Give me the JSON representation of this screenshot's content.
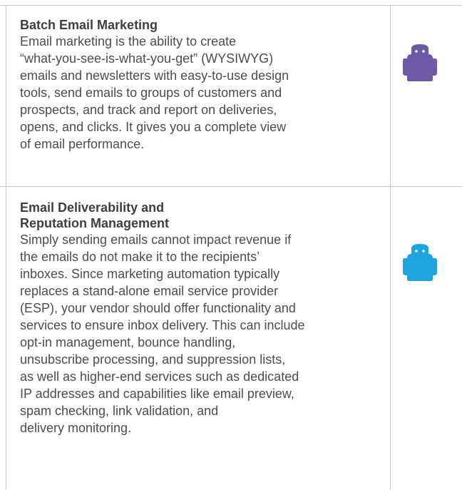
{
  "sections": [
    {
      "heading_lines": [
        "Batch Email Marketing"
      ],
      "body_lines": [
        "Email marketing is the ability to create",
        "“what-you-see-is-what-you-get” (WYSIWYG)",
        "emails and newsletters with easy-to-use design",
        "tools, send emails to groups of customers and",
        "prospects, and track and report on deliveries,",
        "opens, and clicks. It gives you a complete view",
        "of email performance."
      ],
      "icon": "purple-robot-icon",
      "icon_color": "#6c5aa8"
    },
    {
      "heading_lines": [
        "Email Deliverability and",
        "Reputation Management"
      ],
      "body_lines": [
        "Simply sending emails cannot impact revenue if",
        "the emails do not make it to the recipients’",
        "inboxes. Since marketing automation typically",
        "replaces a stand-alone email service provider",
        "(ESP), your vendor should offer functionality and",
        "services to ensure inbox delivery. This can include",
        "opt-in management, bounce handling,",
        "unsubscribe processing, and suppression lists,",
        "as well as higher-end services such as dedicated",
        "IP addresses and capabilities like email preview,",
        "spam checking, link validation, and",
        "delivery monitoring."
      ],
      "icon": "blue-robot-icon",
      "icon_color": "#1ea5e0"
    }
  ]
}
